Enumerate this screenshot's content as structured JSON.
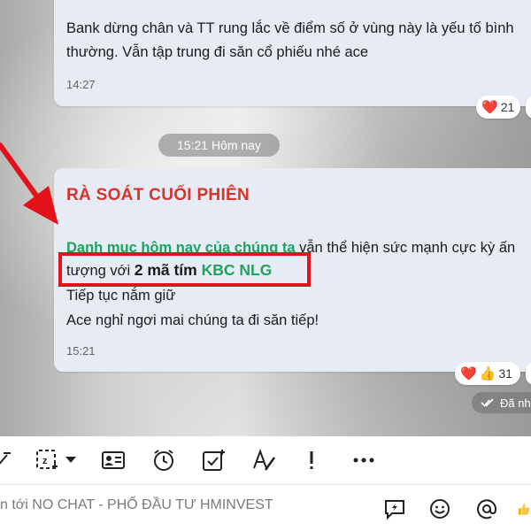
{
  "messages": {
    "first": {
      "line1": "Bank dừng chân và TT rung lắc về điểm số ở vùng này là yếu tố bình",
      "line2": "thường. Vẫn tập trung đi săn cổ phiếu nhé ace",
      "time": "14:27",
      "reaction_emoji": "❤️",
      "reaction_count": "21"
    },
    "date_divider": "15:21 Hôm nay",
    "second": {
      "title": "RÀ SOÁT CUỐI PHIÊN",
      "line1_green": "Danh mục hôm nay của chúng ta",
      "line1_rest": " vẫn thể hiện sức mạnh cực kỳ ấn",
      "line2_prefix": "tượng với ",
      "line2_bold": "2 mã tím ",
      "line2_green": "KBC NLG",
      "line3": "Tiếp tục nắm giữ",
      "line4": "Ace nghỉ ngơi mai chúng ta đi săn tiếp!",
      "time": "15:21",
      "reaction_emoji_1": "❤️",
      "reaction_emoji_2": "👍",
      "reaction_count": "31",
      "seen_label": "Đã nh"
    }
  },
  "toolbar": {
    "icons": [
      "sticker-icon",
      "screenshot-icon",
      "dropdown-icon",
      "contact-card-icon",
      "alarm-icon",
      "task-icon",
      "text-format-icon",
      "urgent-icon",
      "more-icon"
    ]
  },
  "composer": {
    "placeholder": "n tới NO CHAT - PHỐ ĐẦU TƯ HMINVEST",
    "icons": [
      "quick-message-icon",
      "emoji-icon",
      "mention-icon",
      "like-icon"
    ]
  },
  "colors": {
    "bubble": "#e6ebf6",
    "title_red": "#d6342b",
    "green": "#1fa25f",
    "highlight": "#e3111a"
  }
}
